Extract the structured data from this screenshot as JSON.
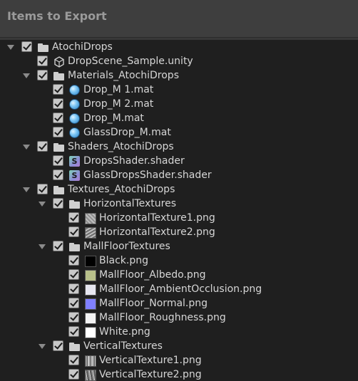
{
  "header": {
    "title": "Items to Export"
  },
  "tree": [
    {
      "depth": 0,
      "arrow": true,
      "icon": "folder-icon",
      "label": "AtochiDrops"
    },
    {
      "depth": 1,
      "arrow": false,
      "icon": "unity-scene-icon",
      "label": "DropScene_Sample.unity"
    },
    {
      "depth": 1,
      "arrow": true,
      "icon": "folder-icon",
      "label": "Materials_AtochiDrops"
    },
    {
      "depth": 2,
      "arrow": false,
      "icon": "material-icon",
      "label": "Drop_M 1.mat"
    },
    {
      "depth": 2,
      "arrow": false,
      "icon": "material-icon",
      "label": "Drop_M 2.mat"
    },
    {
      "depth": 2,
      "arrow": false,
      "icon": "material-icon",
      "label": "Drop_M.mat"
    },
    {
      "depth": 2,
      "arrow": false,
      "icon": "material-icon",
      "label": "GlassDrop_M.mat"
    },
    {
      "depth": 1,
      "arrow": true,
      "icon": "folder-icon",
      "label": "Shaders_AtochiDrops"
    },
    {
      "depth": 2,
      "arrow": false,
      "icon": "shader-icon",
      "label": "DropsShader.shader"
    },
    {
      "depth": 2,
      "arrow": false,
      "icon": "shader-icon",
      "label": "GlassDropsShader.shader"
    },
    {
      "depth": 1,
      "arrow": true,
      "icon": "folder-icon",
      "label": "Textures_AtochiDrops"
    },
    {
      "depth": 2,
      "arrow": true,
      "icon": "folder-icon",
      "label": "HorizontalTextures"
    },
    {
      "depth": 3,
      "arrow": false,
      "icon": "texture-icon",
      "tex": "tex-h1",
      "label": "HorizontalTexture1.png"
    },
    {
      "depth": 3,
      "arrow": false,
      "icon": "texture-icon",
      "tex": "tex-h2",
      "label": "HorizontalTexture2.png"
    },
    {
      "depth": 2,
      "arrow": true,
      "icon": "folder-icon",
      "label": "MallFloorTextures"
    },
    {
      "depth": 3,
      "arrow": false,
      "icon": "texture-icon",
      "tex": "tex-black",
      "label": "Black.png"
    },
    {
      "depth": 3,
      "arrow": false,
      "icon": "texture-icon",
      "tex": "tex-albedo",
      "label": "MallFloor_Albedo.png"
    },
    {
      "depth": 3,
      "arrow": false,
      "icon": "texture-icon",
      "tex": "tex-ao",
      "label": "MallFloor_AmbientOcclusion.png"
    },
    {
      "depth": 3,
      "arrow": false,
      "icon": "texture-icon",
      "tex": "tex-normal",
      "label": "MallFloor_Normal.png"
    },
    {
      "depth": 3,
      "arrow": false,
      "icon": "texture-icon",
      "tex": "tex-rough",
      "label": "MallFloor_Roughness.png"
    },
    {
      "depth": 3,
      "arrow": false,
      "icon": "texture-icon",
      "tex": "tex-white",
      "label": "White.png"
    },
    {
      "depth": 2,
      "arrow": true,
      "icon": "folder-icon",
      "label": "VerticalTextures"
    },
    {
      "depth": 3,
      "arrow": false,
      "icon": "texture-icon",
      "tex": "tex-v1",
      "label": "VerticalTexture1.png"
    },
    {
      "depth": 3,
      "arrow": false,
      "icon": "texture-icon",
      "tex": "tex-v2",
      "label": "VerticalTexture2.png"
    }
  ]
}
